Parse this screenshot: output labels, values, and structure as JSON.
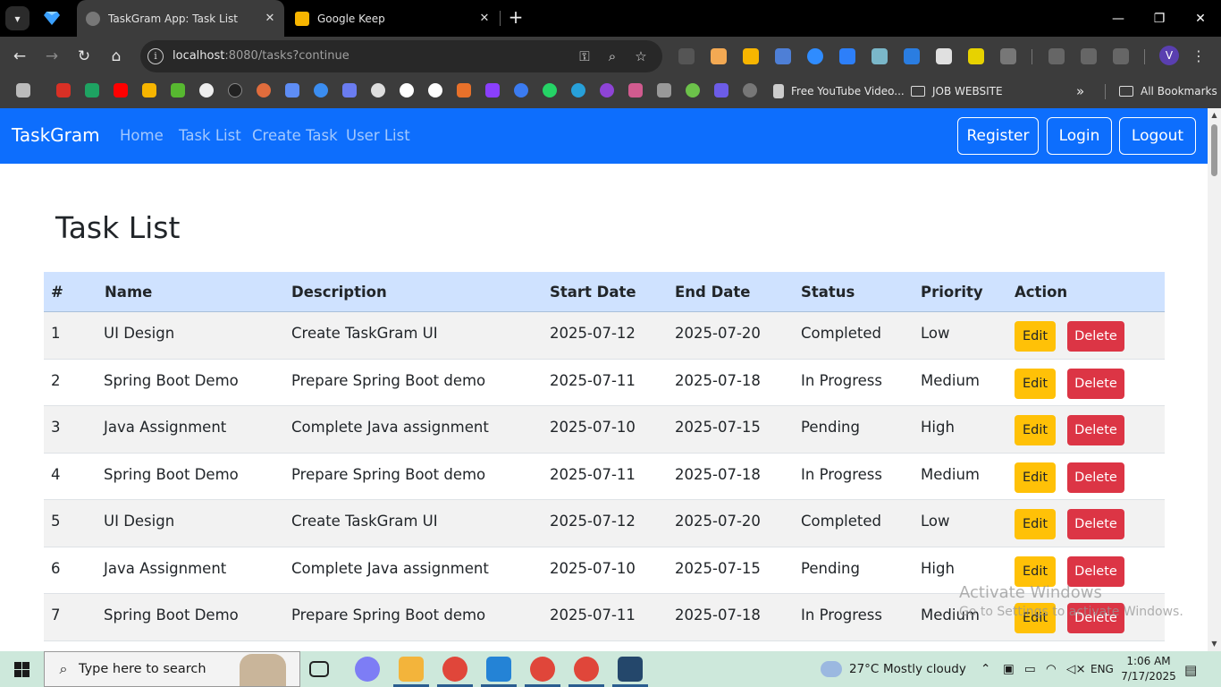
{
  "browser": {
    "tabs": [
      {
        "title": "TaskGram App: Task List",
        "active": true
      },
      {
        "title": "Google Keep",
        "active": false
      }
    ],
    "address": {
      "host": "localhost",
      "rest": ":8080/tasks?continue"
    },
    "bookmarks": {
      "youtube_label": "Free YouTube Video...",
      "folder_label": "JOB WEBSITE",
      "all_label": "All Bookmarks"
    },
    "profile_initial": "V"
  },
  "navbar": {
    "brand": "TaskGram",
    "links": [
      "Home",
      "Task List",
      "Create Task",
      "User List"
    ],
    "buttons": [
      "Register",
      "Login",
      "Logout"
    ]
  },
  "page": {
    "title": "Task List"
  },
  "table": {
    "headers": [
      "#",
      "Name",
      "Description",
      "Start Date",
      "End Date",
      "Status",
      "Priority",
      "Action"
    ],
    "edit_label": "Edit",
    "delete_label": "Delete",
    "rows": [
      [
        "1",
        "UI Design",
        "Create TaskGram UI",
        "2025-07-12",
        "2025-07-20",
        "Completed",
        "Low"
      ],
      [
        "2",
        "Spring Boot Demo",
        "Prepare Spring Boot demo",
        "2025-07-11",
        "2025-07-18",
        "In Progress",
        "Medium"
      ],
      [
        "3",
        "Java Assignment",
        "Complete Java assignment",
        "2025-07-10",
        "2025-07-15",
        "Pending",
        "High"
      ],
      [
        "4",
        "Spring Boot Demo",
        "Prepare Spring Boot demo",
        "2025-07-11",
        "2025-07-18",
        "In Progress",
        "Medium"
      ],
      [
        "5",
        "UI Design",
        "Create TaskGram UI",
        "2025-07-12",
        "2025-07-20",
        "Completed",
        "Low"
      ],
      [
        "6",
        "Java Assignment",
        "Complete Java assignment",
        "2025-07-10",
        "2025-07-15",
        "Pending",
        "High"
      ],
      [
        "7",
        "Spring Boot Demo",
        "Prepare Spring Boot demo",
        "2025-07-11",
        "2025-07-18",
        "In Progress",
        "Medium"
      ]
    ]
  },
  "watermark": {
    "line1": "Activate Windows",
    "line2": "Go to Settings to activate Windows."
  },
  "taskbar": {
    "search_placeholder": "Type here to search",
    "weather_temp": "27°C",
    "weather_text": "Mostly cloudy",
    "language": "ENG",
    "time": "1:06 AM",
    "date": "7/17/2025"
  },
  "colors": {
    "navbar": "#0d6efd",
    "table_header": "#cfe2ff",
    "edit_button": "#ffc107",
    "delete_button": "#dc3545"
  }
}
